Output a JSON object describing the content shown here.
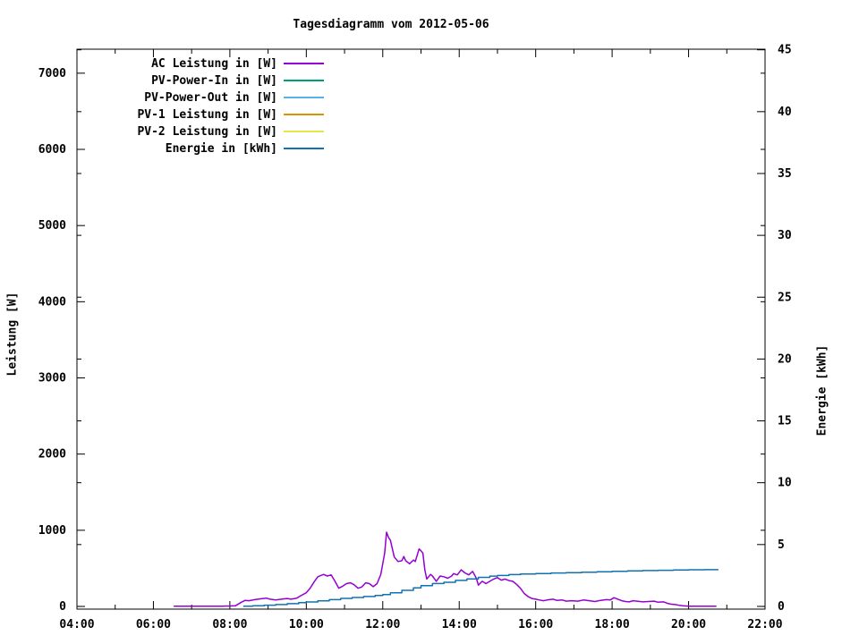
{
  "chart_data": {
    "type": "line",
    "title": "Tagesdiagramm vom 2012-05-06",
    "ylabel": "Leistung [W]",
    "y2label": "Energie [kWh]",
    "x_axis": {
      "min": 4,
      "max": 22,
      "major": [
        {
          "v": 4,
          "label": "04:00"
        },
        {
          "v": 6,
          "label": "06:00"
        },
        {
          "v": 8,
          "label": "08:00"
        },
        {
          "v": 10,
          "label": "10:00"
        },
        {
          "v": 12,
          "label": "12:00"
        },
        {
          "v": 14,
          "label": "14:00"
        },
        {
          "v": 16,
          "label": "16:00"
        },
        {
          "v": 18,
          "label": "18:00"
        },
        {
          "v": 20,
          "label": "20:00"
        },
        {
          "v": 22,
          "label": "22:00"
        }
      ],
      "minor": [
        5,
        7,
        9,
        11,
        13,
        15,
        17,
        19,
        21
      ]
    },
    "y_axis": {
      "min": -35,
      "max": 7315,
      "ticks": [
        {
          "v": 0,
          "label": "0"
        },
        {
          "v": 1000,
          "label": "1000"
        },
        {
          "v": 2000,
          "label": "2000"
        },
        {
          "v": 3000,
          "label": "3000"
        },
        {
          "v": 4000,
          "label": "4000"
        },
        {
          "v": 5000,
          "label": "5000"
        },
        {
          "v": 6000,
          "label": "6000"
        },
        {
          "v": 7000,
          "label": "7000"
        }
      ]
    },
    "y2_axis": {
      "min": -0.22,
      "max": 45.05,
      "ticks": [
        {
          "v": 0,
          "label": "0"
        },
        {
          "v": 5,
          "label": "5"
        },
        {
          "v": 10,
          "label": "10"
        },
        {
          "v": 15,
          "label": "15"
        },
        {
          "v": 20,
          "label": "20"
        },
        {
          "v": 25,
          "label": "25"
        },
        {
          "v": 30,
          "label": "30"
        },
        {
          "v": 35,
          "label": "35"
        },
        {
          "v": 40,
          "label": "40"
        },
        {
          "v": 45,
          "label": "45"
        }
      ]
    },
    "legend": [
      {
        "label": "AC Leistung in [W]",
        "color": "#9400d3"
      },
      {
        "label": "PV-Power-In in [W]",
        "color": "#009e73"
      },
      {
        "label": "PV-Power-Out in [W]",
        "color": "#58b2e6"
      },
      {
        "label": "PV-1 Leistung in [W]",
        "color": "#d99500"
      },
      {
        "label": "PV-2 Leistung in [W]",
        "color": "#e9e649"
      },
      {
        "label": "Energie in [kWh]",
        "color": "#1072b2"
      }
    ],
    "series": [
      {
        "name": "AC Leistung in [W]",
        "color": "#9400d3",
        "axis": "y",
        "mode": "line",
        "points": [
          [
            6.53,
            2
          ],
          [
            6.8,
            2
          ],
          [
            7.0,
            3
          ],
          [
            7.2,
            2
          ],
          [
            7.5,
            3
          ],
          [
            7.8,
            4
          ],
          [
            8.0,
            6
          ],
          [
            8.15,
            10
          ],
          [
            8.3,
            55
          ],
          [
            8.4,
            80
          ],
          [
            8.5,
            75
          ],
          [
            8.65,
            90
          ],
          [
            8.8,
            100
          ],
          [
            8.95,
            110
          ],
          [
            9.05,
            95
          ],
          [
            9.2,
            85
          ],
          [
            9.35,
            95
          ],
          [
            9.5,
            105
          ],
          [
            9.6,
            95
          ],
          [
            9.75,
            110
          ],
          [
            9.85,
            140
          ],
          [
            10.0,
            180
          ],
          [
            10.1,
            240
          ],
          [
            10.2,
            320
          ],
          [
            10.3,
            390
          ],
          [
            10.45,
            420
          ],
          [
            10.55,
            400
          ],
          [
            10.65,
            415
          ],
          [
            10.75,
            330
          ],
          [
            10.85,
            240
          ],
          [
            10.95,
            265
          ],
          [
            11.05,
            300
          ],
          [
            11.15,
            310
          ],
          [
            11.25,
            285
          ],
          [
            11.35,
            240
          ],
          [
            11.45,
            255
          ],
          [
            11.55,
            310
          ],
          [
            11.65,
            300
          ],
          [
            11.75,
            260
          ],
          [
            11.85,
            300
          ],
          [
            11.95,
            420
          ],
          [
            12.05,
            700
          ],
          [
            12.1,
            975
          ],
          [
            12.15,
            905
          ],
          [
            12.2,
            870
          ],
          [
            12.3,
            650
          ],
          [
            12.4,
            590
          ],
          [
            12.5,
            600
          ],
          [
            12.55,
            655
          ],
          [
            12.6,
            600
          ],
          [
            12.7,
            560
          ],
          [
            12.8,
            610
          ],
          [
            12.85,
            590
          ],
          [
            12.95,
            755
          ],
          [
            13.0,
            730
          ],
          [
            13.05,
            700
          ],
          [
            13.1,
            480
          ],
          [
            13.15,
            360
          ],
          [
            13.25,
            420
          ],
          [
            13.3,
            400
          ],
          [
            13.4,
            330
          ],
          [
            13.5,
            400
          ],
          [
            13.6,
            390
          ],
          [
            13.7,
            370
          ],
          [
            13.8,
            400
          ],
          [
            13.85,
            430
          ],
          [
            13.95,
            415
          ],
          [
            14.05,
            480
          ],
          [
            14.15,
            440
          ],
          [
            14.25,
            415
          ],
          [
            14.35,
            460
          ],
          [
            14.45,
            370
          ],
          [
            14.5,
            280
          ],
          [
            14.6,
            330
          ],
          [
            14.7,
            300
          ],
          [
            14.8,
            330
          ],
          [
            14.9,
            360
          ],
          [
            15.0,
            380
          ],
          [
            15.1,
            345
          ],
          [
            15.2,
            360
          ],
          [
            15.3,
            340
          ],
          [
            15.4,
            330
          ],
          [
            15.5,
            290
          ],
          [
            15.6,
            240
          ],
          [
            15.7,
            170
          ],
          [
            15.8,
            130
          ],
          [
            15.9,
            105
          ],
          [
            16.0,
            95
          ],
          [
            16.1,
            85
          ],
          [
            16.2,
            75
          ],
          [
            16.3,
            85
          ],
          [
            16.45,
            95
          ],
          [
            16.55,
            80
          ],
          [
            16.7,
            85
          ],
          [
            16.8,
            70
          ],
          [
            16.95,
            75
          ],
          [
            17.1,
            70
          ],
          [
            17.25,
            85
          ],
          [
            17.4,
            75
          ],
          [
            17.55,
            65
          ],
          [
            17.7,
            80
          ],
          [
            17.85,
            90
          ],
          [
            17.95,
            85
          ],
          [
            18.05,
            115
          ],
          [
            18.15,
            95
          ],
          [
            18.25,
            75
          ],
          [
            18.35,
            65
          ],
          [
            18.45,
            60
          ],
          [
            18.55,
            75
          ],
          [
            18.65,
            70
          ],
          [
            18.8,
            60
          ],
          [
            18.95,
            65
          ],
          [
            19.1,
            70
          ],
          [
            19.2,
            55
          ],
          [
            19.35,
            60
          ],
          [
            19.45,
            40
          ],
          [
            19.55,
            30
          ],
          [
            19.65,
            25
          ],
          [
            19.75,
            15
          ],
          [
            19.85,
            8
          ],
          [
            20.0,
            4
          ],
          [
            20.2,
            3
          ],
          [
            20.5,
            3
          ],
          [
            20.73,
            2
          ]
        ]
      },
      {
        "name": "PV-Power-In in [W]",
        "color": "#009e73",
        "axis": "y",
        "mode": "line",
        "points": []
      },
      {
        "name": "PV-Power-Out in [W]",
        "color": "#58b2e6",
        "axis": "y",
        "mode": "line",
        "points": []
      },
      {
        "name": "PV-1 Leistung in [W]",
        "color": "#d99500",
        "axis": "y",
        "mode": "line",
        "points": []
      },
      {
        "name": "PV-2 Leistung in [W]",
        "color": "#e9e649",
        "axis": "y",
        "mode": "line",
        "points": []
      },
      {
        "name": "Energie in [kWh]",
        "color": "#1072b2",
        "axis": "y2",
        "mode": "steps",
        "points": [
          [
            8.35,
            0.02
          ],
          [
            8.6,
            0.05
          ],
          [
            8.9,
            0.1
          ],
          [
            9.2,
            0.15
          ],
          [
            9.5,
            0.22
          ],
          [
            9.8,
            0.3
          ],
          [
            10.0,
            0.36
          ],
          [
            10.3,
            0.45
          ],
          [
            10.6,
            0.55
          ],
          [
            10.9,
            0.65
          ],
          [
            11.2,
            0.72
          ],
          [
            11.5,
            0.8
          ],
          [
            11.8,
            0.88
          ],
          [
            12.0,
            0.95
          ],
          [
            12.2,
            1.1
          ],
          [
            12.5,
            1.3
          ],
          [
            12.8,
            1.5
          ],
          [
            13.0,
            1.68
          ],
          [
            13.3,
            1.85
          ],
          [
            13.6,
            1.95
          ],
          [
            13.9,
            2.1
          ],
          [
            14.2,
            2.22
          ],
          [
            14.5,
            2.35
          ],
          [
            14.8,
            2.45
          ],
          [
            15.0,
            2.5
          ],
          [
            15.3,
            2.57
          ],
          [
            15.6,
            2.62
          ],
          [
            16.0,
            2.65
          ],
          [
            16.4,
            2.7
          ],
          [
            16.8,
            2.73
          ],
          [
            17.2,
            2.77
          ],
          [
            17.6,
            2.8
          ],
          [
            18.0,
            2.84
          ],
          [
            18.4,
            2.87
          ],
          [
            18.8,
            2.9
          ],
          [
            19.2,
            2.92
          ],
          [
            19.6,
            2.94
          ],
          [
            20.0,
            2.96
          ],
          [
            20.4,
            2.97
          ],
          [
            20.78,
            2.97
          ]
        ]
      }
    ]
  }
}
